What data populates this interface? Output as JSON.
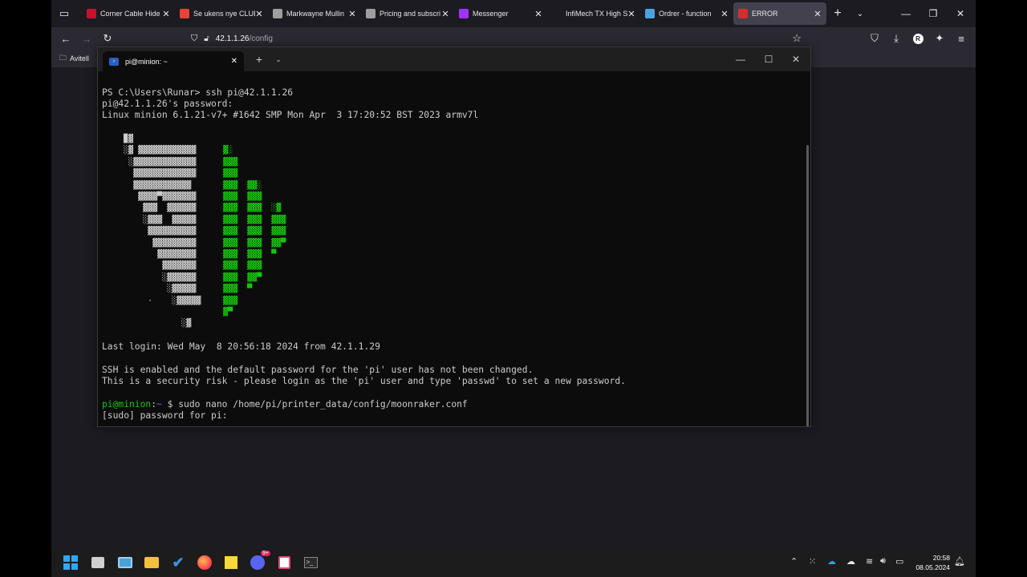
{
  "browser": {
    "tabs": [
      {
        "title": "Corner Cable Hide",
        "favicon": "sketch-red-icon",
        "color": "#c8102e"
      },
      {
        "title": "Se ukens nye CLUB",
        "favicon": "gmail-icon",
        "color": "#ea4335"
      },
      {
        "title": "Markwayne Mullin",
        "favicon": "star-icon",
        "color": "#9e9e9e"
      },
      {
        "title": "Pricing and subscri",
        "favicon": "page-icon",
        "color": "#9e9e9e"
      },
      {
        "title": "Messenger",
        "favicon": "messenger-icon",
        "color": "#a033ff"
      },
      {
        "title": "InfiMech TX High Spe",
        "favicon": "blank-icon",
        "color": "#1c1b22"
      },
      {
        "title": "Ordrer - function",
        "favicon": "document-icon",
        "color": "#4aa3df"
      },
      {
        "title": "ERROR",
        "favicon": "warning-icon",
        "color": "#d32f2f",
        "active": true
      }
    ],
    "url_host": "42.1.1.26",
    "url_path": "/config",
    "bookmark": "Avitell",
    "profile_initial": "R"
  },
  "terminal": {
    "tab_title": "pi@minion: ~",
    "lines": [
      {
        "text": "PS C:\\Users\\Runar> ssh pi@42.1.1.26"
      },
      {
        "text": "pi@42.1.1.26's password:"
      },
      {
        "text": "Linux minion 6.1.21-v7+ #1642 SMP Mon Apr  3 17:20:52 BST 2023 armv7l"
      },
      {
        "text": "Last login: Wed May  8 20:56:18 2024 from 42.1.1.29"
      },
      {
        "text": "SSH is enabled and the default password for the 'pi' user has not been changed."
      },
      {
        "text": "This is a security risk - please login as the 'pi' user and type 'passwd' to set a new password."
      },
      {
        "text": "[sudo] password for pi:"
      }
    ],
    "prompt": {
      "user_host": "pi@minion",
      "sep": ":",
      "path": "~",
      "symbol": " $",
      "command": " sudo nano /home/pi/printer_data/config/moonraker.conf"
    },
    "logo_white": [
      "  ▉▓",
      "  ░▓ ▓▓▓▓▓▓▓▓▓▓▓▓",
      "   ░▓▓▓▓▓▓▓▓▓▓▓▓▓",
      "    ▓▓▓▓▓▓▓▓▓▓▓▓▓",
      "    ▓▓▓▓▓▓▓▓▓▓▓▓",
      "     ▓▓▓▓▀▓▓▓▓▓▓▓",
      "      ▓▓▓  ▓▓▓▓▓▓",
      "      ░▓▓▓  ▓▓▓▓▓",
      "       ▓▓▓▓▓▓▓▓▓▓",
      "        ▓▓▓▓▓▓▓▓▓",
      "         ▓▓▓▓▓▓▓▓",
      "          ▓▓▓▓▓▓▓",
      "          ░▓▓▓▓▓▓",
      "           ░▓▓▓▓▓",
      "       ·    ░▓▓▓▓▓",
      "",
      "              ░▓"
    ],
    "logo_green": [
      "",
      "   ▓░",
      "   ▓▓▓",
      "   ▓▓▓",
      "   ▓▓▓  ▓▓░",
      "   ▓▓▓  ▓▓▓",
      "   ▓▓▓  ▓▓▓  ░▓",
      "   ▓▓▓  ▓▓▓  ▓▓▓",
      "   ▓▓▓  ▓▓▓  ▓▓▓",
      "   ▓▓▓  ▓▓▓  ▓▓▀",
      "   ▓▓▓  ▓▓▓  ▀",
      "   ▓▓▓  ▓▓▓",
      "   ▓▓▓  ▓▓▀",
      "   ▓▓▓  ▀",
      "   ▓▓▓",
      "   ▓▀"
    ]
  },
  "taskbar": {
    "apps": [
      "windows-start-icon",
      "file-icon",
      "photos-icon",
      "file-explorer-icon",
      "todo-icon",
      "firefox-icon",
      "sticky-notes-icon",
      "discord-icon",
      "snipping-tool-icon",
      "terminal-icon"
    ],
    "discord_badge": "9+",
    "time": "20:58",
    "date": "08.05.2024"
  },
  "colors": {
    "green": "#16c60c",
    "blue": "#3b78ff",
    "terminal_bg": "#0c0c0c"
  }
}
